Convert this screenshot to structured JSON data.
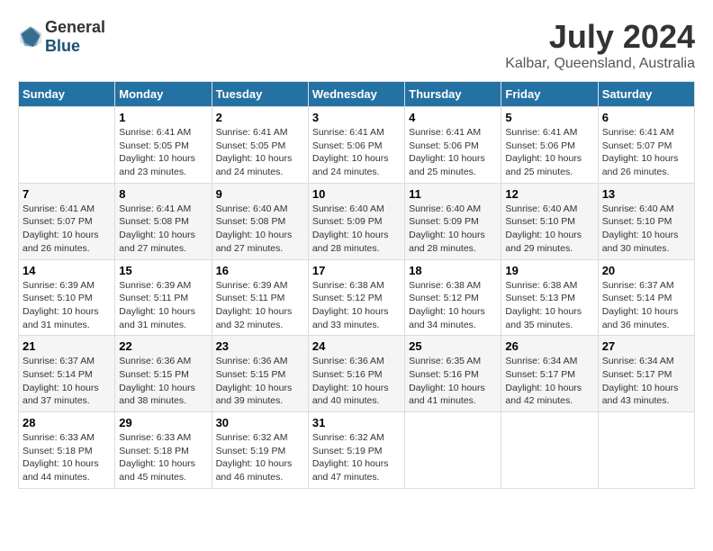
{
  "header": {
    "logo_general": "General",
    "logo_blue": "Blue",
    "month": "July 2024",
    "location": "Kalbar, Queensland, Australia"
  },
  "days_of_week": [
    "Sunday",
    "Monday",
    "Tuesday",
    "Wednesday",
    "Thursday",
    "Friday",
    "Saturday"
  ],
  "weeks": [
    [
      {
        "day": "",
        "detail": ""
      },
      {
        "day": "1",
        "detail": "Sunrise: 6:41 AM\nSunset: 5:05 PM\nDaylight: 10 hours\nand 23 minutes."
      },
      {
        "day": "2",
        "detail": "Sunrise: 6:41 AM\nSunset: 5:05 PM\nDaylight: 10 hours\nand 24 minutes."
      },
      {
        "day": "3",
        "detail": "Sunrise: 6:41 AM\nSunset: 5:06 PM\nDaylight: 10 hours\nand 24 minutes."
      },
      {
        "day": "4",
        "detail": "Sunrise: 6:41 AM\nSunset: 5:06 PM\nDaylight: 10 hours\nand 25 minutes."
      },
      {
        "day": "5",
        "detail": "Sunrise: 6:41 AM\nSunset: 5:06 PM\nDaylight: 10 hours\nand 25 minutes."
      },
      {
        "day": "6",
        "detail": "Sunrise: 6:41 AM\nSunset: 5:07 PM\nDaylight: 10 hours\nand 26 minutes."
      }
    ],
    [
      {
        "day": "7",
        "detail": "Sunrise: 6:41 AM\nSunset: 5:07 PM\nDaylight: 10 hours\nand 26 minutes."
      },
      {
        "day": "8",
        "detail": "Sunrise: 6:41 AM\nSunset: 5:08 PM\nDaylight: 10 hours\nand 27 minutes."
      },
      {
        "day": "9",
        "detail": "Sunrise: 6:40 AM\nSunset: 5:08 PM\nDaylight: 10 hours\nand 27 minutes."
      },
      {
        "day": "10",
        "detail": "Sunrise: 6:40 AM\nSunset: 5:09 PM\nDaylight: 10 hours\nand 28 minutes."
      },
      {
        "day": "11",
        "detail": "Sunrise: 6:40 AM\nSunset: 5:09 PM\nDaylight: 10 hours\nand 28 minutes."
      },
      {
        "day": "12",
        "detail": "Sunrise: 6:40 AM\nSunset: 5:10 PM\nDaylight: 10 hours\nand 29 minutes."
      },
      {
        "day": "13",
        "detail": "Sunrise: 6:40 AM\nSunset: 5:10 PM\nDaylight: 10 hours\nand 30 minutes."
      }
    ],
    [
      {
        "day": "14",
        "detail": "Sunrise: 6:39 AM\nSunset: 5:10 PM\nDaylight: 10 hours\nand 31 minutes."
      },
      {
        "day": "15",
        "detail": "Sunrise: 6:39 AM\nSunset: 5:11 PM\nDaylight: 10 hours\nand 31 minutes."
      },
      {
        "day": "16",
        "detail": "Sunrise: 6:39 AM\nSunset: 5:11 PM\nDaylight: 10 hours\nand 32 minutes."
      },
      {
        "day": "17",
        "detail": "Sunrise: 6:38 AM\nSunset: 5:12 PM\nDaylight: 10 hours\nand 33 minutes."
      },
      {
        "day": "18",
        "detail": "Sunrise: 6:38 AM\nSunset: 5:12 PM\nDaylight: 10 hours\nand 34 minutes."
      },
      {
        "day": "19",
        "detail": "Sunrise: 6:38 AM\nSunset: 5:13 PM\nDaylight: 10 hours\nand 35 minutes."
      },
      {
        "day": "20",
        "detail": "Sunrise: 6:37 AM\nSunset: 5:14 PM\nDaylight: 10 hours\nand 36 minutes."
      }
    ],
    [
      {
        "day": "21",
        "detail": "Sunrise: 6:37 AM\nSunset: 5:14 PM\nDaylight: 10 hours\nand 37 minutes."
      },
      {
        "day": "22",
        "detail": "Sunrise: 6:36 AM\nSunset: 5:15 PM\nDaylight: 10 hours\nand 38 minutes."
      },
      {
        "day": "23",
        "detail": "Sunrise: 6:36 AM\nSunset: 5:15 PM\nDaylight: 10 hours\nand 39 minutes."
      },
      {
        "day": "24",
        "detail": "Sunrise: 6:36 AM\nSunset: 5:16 PM\nDaylight: 10 hours\nand 40 minutes."
      },
      {
        "day": "25",
        "detail": "Sunrise: 6:35 AM\nSunset: 5:16 PM\nDaylight: 10 hours\nand 41 minutes."
      },
      {
        "day": "26",
        "detail": "Sunrise: 6:34 AM\nSunset: 5:17 PM\nDaylight: 10 hours\nand 42 minutes."
      },
      {
        "day": "27",
        "detail": "Sunrise: 6:34 AM\nSunset: 5:17 PM\nDaylight: 10 hours\nand 43 minutes."
      }
    ],
    [
      {
        "day": "28",
        "detail": "Sunrise: 6:33 AM\nSunset: 5:18 PM\nDaylight: 10 hours\nand 44 minutes."
      },
      {
        "day": "29",
        "detail": "Sunrise: 6:33 AM\nSunset: 5:18 PM\nDaylight: 10 hours\nand 45 minutes."
      },
      {
        "day": "30",
        "detail": "Sunrise: 6:32 AM\nSunset: 5:19 PM\nDaylight: 10 hours\nand 46 minutes."
      },
      {
        "day": "31",
        "detail": "Sunrise: 6:32 AM\nSunset: 5:19 PM\nDaylight: 10 hours\nand 47 minutes."
      },
      {
        "day": "",
        "detail": ""
      },
      {
        "day": "",
        "detail": ""
      },
      {
        "day": "",
        "detail": ""
      }
    ]
  ]
}
